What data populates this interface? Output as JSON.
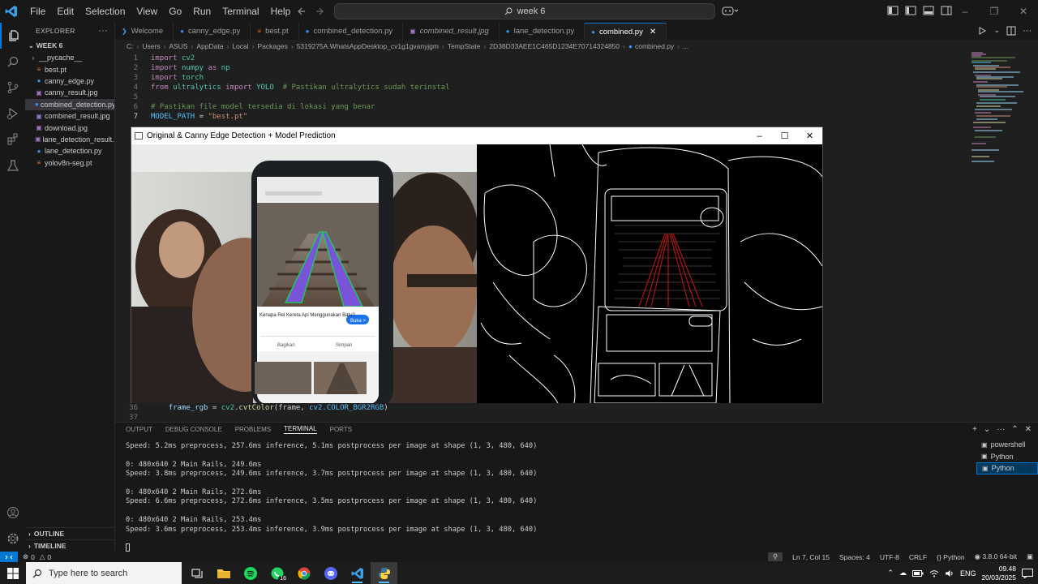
{
  "titlebar": {
    "menus": [
      "File",
      "Edit",
      "Selection",
      "View",
      "Go",
      "Run",
      "Terminal",
      "Help"
    ],
    "search": "week 6"
  },
  "sidebar": {
    "header": "EXPLORER",
    "folder": "WEEK 6",
    "files": [
      {
        "name": "__pycache__",
        "type": "folder"
      },
      {
        "name": "best.pt",
        "type": "pt"
      },
      {
        "name": "canny_edge.py",
        "type": "py"
      },
      {
        "name": "canny_result.jpg",
        "type": "img"
      },
      {
        "name": "combined_detection.py",
        "type": "py"
      },
      {
        "name": "combined_result.jpg",
        "type": "img"
      },
      {
        "name": "download.jpg",
        "type": "img"
      },
      {
        "name": "lane_detection_result....",
        "type": "img"
      },
      {
        "name": "lane_detection.py",
        "type": "py"
      },
      {
        "name": "yolov8n-seg.pt",
        "type": "pt"
      }
    ],
    "outline": "OUTLINE",
    "timeline": "TIMELINE"
  },
  "tabs": [
    {
      "label": "Welcome",
      "icon": "vscode-icon"
    },
    {
      "label": "canny_edge.py",
      "icon": "python-icon"
    },
    {
      "label": "best.pt",
      "icon": "pt-icon"
    },
    {
      "label": "combined_detection.py",
      "icon": "python-icon"
    },
    {
      "label": "combined_result.jpg",
      "icon": "image-icon"
    },
    {
      "label": "lane_detection.py",
      "icon": "python-icon"
    },
    {
      "label": "combined.py",
      "icon": "python-icon"
    }
  ],
  "breadcrumb": [
    "C:",
    "Users",
    "ASUS",
    "AppData",
    "Local",
    "Packages",
    "5319275A.WhatsAppDesktop_cv1g1gvanyjgm",
    "TempState",
    "2D38D33AEE1C465D1234E70714324850",
    "combined.py",
    "..."
  ],
  "code": {
    "l1": {
      "num": "1",
      "kw": "import",
      "mod": "cv2"
    },
    "l2": {
      "num": "2",
      "kw": "import",
      "mod": "numpy",
      "kw2": "as",
      "alias": "np"
    },
    "l3": {
      "num": "3",
      "kw": "import",
      "mod": "torch"
    },
    "l4": {
      "num": "4",
      "kw": "from",
      "mod": "ultralytics",
      "kw2": "import",
      "cls": "YOLO",
      "cmt": "# Pastikan ultralytics sudah terinstal"
    },
    "l5": {
      "num": "5"
    },
    "l6": {
      "num": "6",
      "cmt": "# Pastikan file model tersedia di lokasi yang benar"
    },
    "l7": {
      "num": "7",
      "var": "MODEL_PATH",
      "op": " = ",
      "str": "\"best.pt\""
    },
    "l36": {
      "num": "36",
      "var": "frame_rgb",
      "op": " = ",
      "mod": "cv2",
      "fn": "cvtColor",
      "args": "(frame, ",
      "const": "cv2.COLOR_BGR2RGB",
      "close": ")"
    },
    "l37": {
      "num": "37"
    }
  },
  "cvwindow": {
    "title": "Original & Canny Edge Detection + Model Prediction",
    "phone_text": {
      "question": "Kenapa Rel Kereta Api Menggunakan Batu?",
      "button": "Buka >",
      "left": "Bagikan",
      "right": "Simpan"
    }
  },
  "panel": {
    "tabs": [
      "OUTPUT",
      "DEBUG CONSOLE",
      "PROBLEMS",
      "TERMINAL",
      "PORTS"
    ],
    "active_tab": "TERMINAL",
    "terminal_lines": [
      "Speed: 5.2ms preprocess, 257.6ms inference, 5.1ms postprocess per image at shape (1, 3, 480, 640)",
      "",
      "0: 480x640 2 Main Rails, 249.6ms",
      "Speed: 3.8ms preprocess, 249.6ms inference, 3.7ms postprocess per image at shape (1, 3, 480, 640)",
      "",
      "0: 480x640 2 Main Rails, 272.6ms",
      "Speed: 6.6ms preprocess, 272.6ms inference, 3.5ms postprocess per image at shape (1, 3, 480, 640)",
      "",
      "0: 480x640 2 Main Rails, 253.4ms",
      "Speed: 3.6ms preprocess, 253.4ms inference, 3.9ms postprocess per image at shape (1, 3, 480, 640)"
    ],
    "terminals": [
      "powershell",
      "Python",
      "Python"
    ]
  },
  "statusbar": {
    "errors": "0",
    "warnings": "0",
    "position": "Ln 7, Col 15",
    "spaces": "Spaces: 4",
    "encoding": "UTF-8",
    "eol": "CRLF",
    "language": "Python",
    "interpreter": "3.8.0 64-bit"
  },
  "taskbar": {
    "search_placeholder": "Type here to search",
    "whatsapp_badge": "16",
    "lang": "ENG",
    "time": "09.48",
    "date": "20/03/2025"
  },
  "colors": {
    "accent": "#0078d4",
    "editor_bg": "#1f1f1f",
    "chrome_bg": "#181818"
  }
}
